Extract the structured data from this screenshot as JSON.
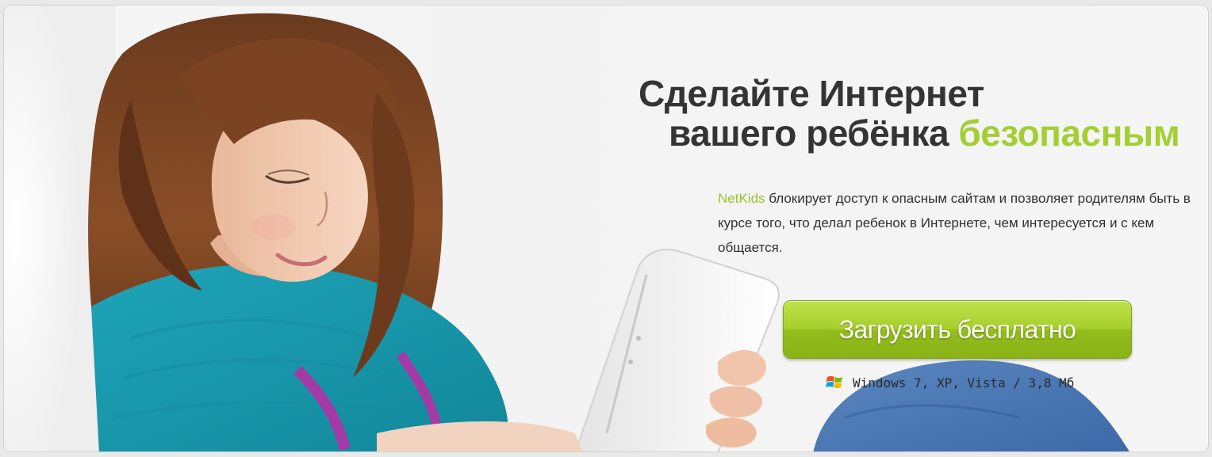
{
  "hero": {
    "headline_line1": "Сделайте Интернет",
    "headline_line2": "вашего ребёнка",
    "headline_accent": "безопасным"
  },
  "description": {
    "brand": "NetKids",
    "text": " блокирует доступ к опасным сайтам и позволяет родителям быть в курсе того, что делал ребенок в Интернете, чем интересуется и с кем общается."
  },
  "download": {
    "button_label": "Загрузить бесплатно",
    "os_info": "Windows 7, XP, Vista / 3,8 Мб"
  },
  "colors": {
    "accent": "#a3cf35",
    "button": "#9cc624",
    "headline": "#343434"
  },
  "icons": {
    "os": "windows-logo-icon"
  }
}
